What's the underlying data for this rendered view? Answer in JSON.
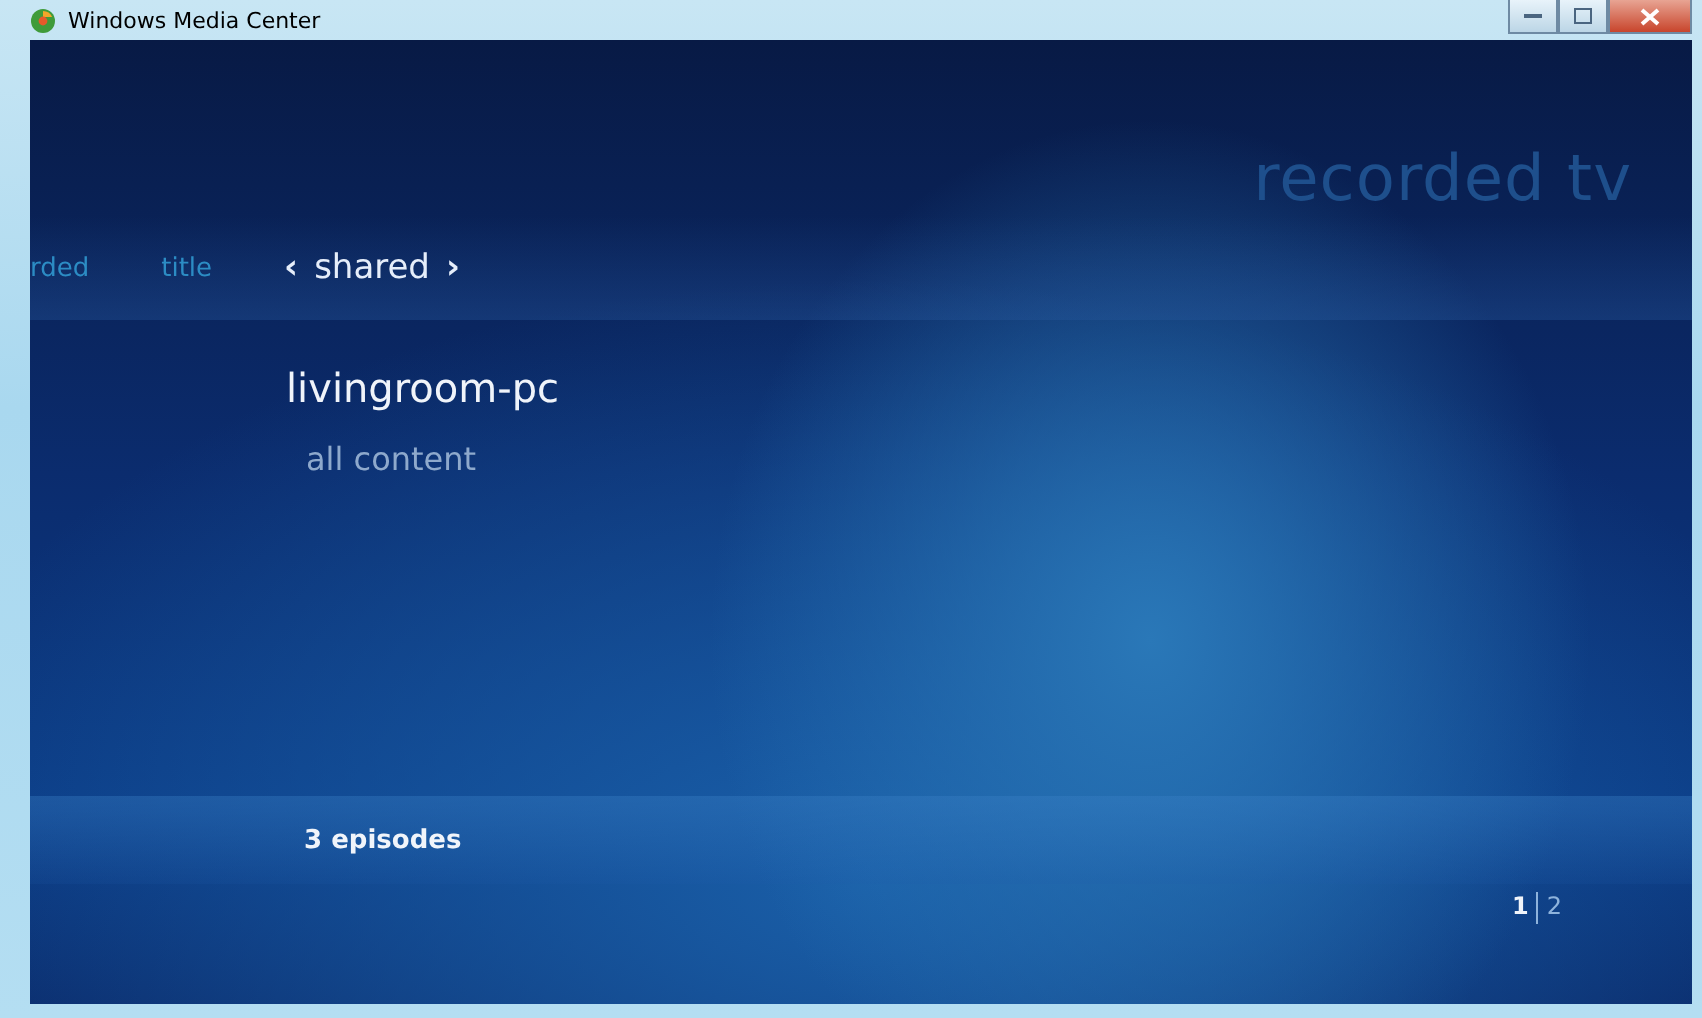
{
  "window": {
    "title": "Windows Media Center"
  },
  "header": {
    "title": "recorded tv"
  },
  "pivot": [
    {
      "label": "rded",
      "selected": false
    },
    {
      "label": "title",
      "selected": false
    },
    {
      "label": "shared",
      "selected": true,
      "prev": "‹",
      "next": "›"
    }
  ],
  "library": {
    "name": "livingroom-pc",
    "items": [
      {
        "label": "all content"
      }
    ]
  },
  "footer": {
    "count": "3 episodes"
  },
  "pages": [
    {
      "label": "1",
      "selected": true
    },
    {
      "label": "2",
      "selected": false
    }
  ]
}
